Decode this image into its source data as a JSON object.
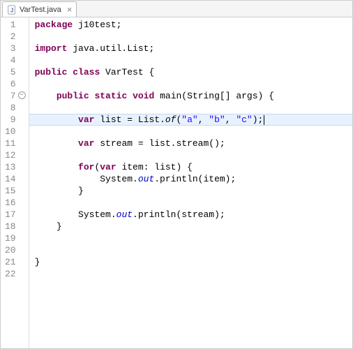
{
  "tab": {
    "filename": "VarTest.java",
    "close_label": "×"
  },
  "gutter": {
    "fold_line": 7,
    "lines": [
      "1",
      "2",
      "3",
      "4",
      "5",
      "6",
      "7",
      "8",
      "9",
      "10",
      "11",
      "12",
      "13",
      "14",
      "15",
      "16",
      "17",
      "18",
      "19",
      "20",
      "21",
      "22"
    ]
  },
  "code": {
    "highlighted_line": 9,
    "tokens": {
      "l1": [
        {
          "t": "package",
          "c": "kw"
        },
        {
          "t": " j10test;"
        }
      ],
      "l2": [
        {
          "t": ""
        }
      ],
      "l3": [
        {
          "t": "import",
          "c": "kw"
        },
        {
          "t": " java.util.List;"
        }
      ],
      "l4": [
        {
          "t": ""
        }
      ],
      "l5": [
        {
          "t": "public",
          "c": "kw"
        },
        {
          "t": " "
        },
        {
          "t": "class",
          "c": "kw"
        },
        {
          "t": " VarTest {"
        }
      ],
      "l6": [
        {
          "t": ""
        }
      ],
      "l7": [
        {
          "t": "    "
        },
        {
          "t": "public",
          "c": "kw"
        },
        {
          "t": " "
        },
        {
          "t": "static",
          "c": "kw"
        },
        {
          "t": " "
        },
        {
          "t": "void",
          "c": "kw"
        },
        {
          "t": " main(String[] args) {"
        }
      ],
      "l8": [
        {
          "t": ""
        }
      ],
      "l9": [
        {
          "t": "        "
        },
        {
          "t": "var",
          "c": "kw"
        },
        {
          "t": " list = List."
        },
        {
          "t": "of",
          "c": "staticm"
        },
        {
          "t": "("
        },
        {
          "t": "\"a\"",
          "c": "str"
        },
        {
          "t": ", "
        },
        {
          "t": "\"b\"",
          "c": "str"
        },
        {
          "t": ", "
        },
        {
          "t": "\"c\"",
          "c": "str"
        },
        {
          "t": ");"
        }
      ],
      "l10": [
        {
          "t": ""
        }
      ],
      "l11": [
        {
          "t": "        "
        },
        {
          "t": "var",
          "c": "kw"
        },
        {
          "t": " stream = list.stream();"
        }
      ],
      "l12": [
        {
          "t": ""
        }
      ],
      "l13": [
        {
          "t": "        "
        },
        {
          "t": "for",
          "c": "kw"
        },
        {
          "t": "("
        },
        {
          "t": "var",
          "c": "kw"
        },
        {
          "t": " item: list) {"
        }
      ],
      "l14": [
        {
          "t": "            System."
        },
        {
          "t": "out",
          "c": "field"
        },
        {
          "t": ".println(item);"
        }
      ],
      "l15": [
        {
          "t": "        }"
        }
      ],
      "l16": [
        {
          "t": ""
        }
      ],
      "l17": [
        {
          "t": "        System."
        },
        {
          "t": "out",
          "c": "field"
        },
        {
          "t": ".println(stream);"
        }
      ],
      "l18": [
        {
          "t": "    }"
        }
      ],
      "l19": [
        {
          "t": ""
        }
      ],
      "l20": [
        {
          "t": ""
        }
      ],
      "l21": [
        {
          "t": "}"
        }
      ],
      "l22": [
        {
          "t": ""
        }
      ]
    }
  }
}
